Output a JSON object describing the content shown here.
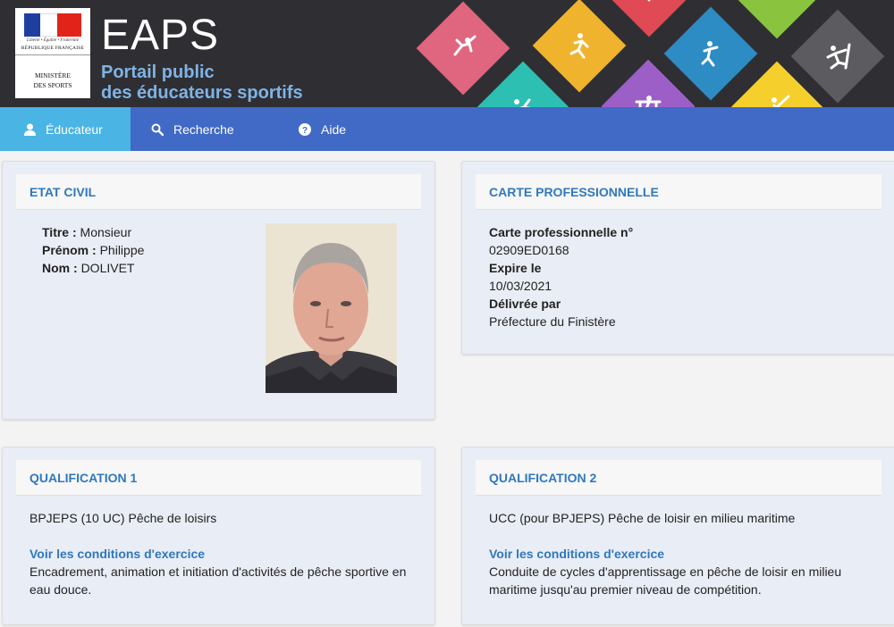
{
  "header": {
    "brand": "EAPS",
    "tagline_line1": "Portail public",
    "tagline_line2": "des éducateurs sportifs",
    "logo": {
      "motto": "Liberté • Égalité • Fraternité",
      "republic": "RÉPUBLIQUE FRANÇAISE",
      "ministry_line1": "MINISTÈRE",
      "ministry_line2": "DES SPORTS"
    }
  },
  "nav": {
    "items": [
      {
        "label": "Éducateur",
        "icon": "user-icon",
        "active": true
      },
      {
        "label": "Recherche",
        "icon": "search-icon",
        "active": false
      },
      {
        "label": "Aide",
        "icon": "help-icon",
        "active": false
      }
    ]
  },
  "etat_civil": {
    "title": "ETAT CIVIL",
    "titre_label": "Titre :",
    "titre_value": "Monsieur",
    "prenom_label": "Prénom :",
    "prenom_value": "Philippe",
    "nom_label": "Nom :",
    "nom_value": "DOLIVET"
  },
  "carte": {
    "title": "CARTE PROFESSIONNELLE",
    "numero_label": "Carte professionnelle n°",
    "numero_value": "02909ED0168",
    "expire_label": "Expire le",
    "expire_value": "10/03/2021",
    "delivree_label": "Délivrée par",
    "delivree_value": "Préfecture du Finistère"
  },
  "qualifications": [
    {
      "title": "QUALIFICATION 1",
      "diploma": "BPJEPS (10 UC) Pêche de loisirs",
      "link": "Voir les conditions d'exercice",
      "description_line1": "Encadrement, animation et initiation d'activités de pêche sportive en",
      "description_line2": "eau douce."
    },
    {
      "title": "QUALIFICATION 2",
      "diploma": "UCC (pour BPJEPS) Pêche de loisir en milieu maritime",
      "link": "Voir les conditions d'exercice",
      "description_line1": "Conduite de cycles d'apprentissage en pêche de loisir en milieu",
      "description_line2": "maritime jusqu'au premier niveau de compétition."
    }
  ],
  "colors": {
    "header_bg": "#2f2f33",
    "nav_bg": "#4169c6",
    "nav_active": "#4ab4e4",
    "section_title": "#2f78bd",
    "panel_bg": "#e9edf6"
  }
}
